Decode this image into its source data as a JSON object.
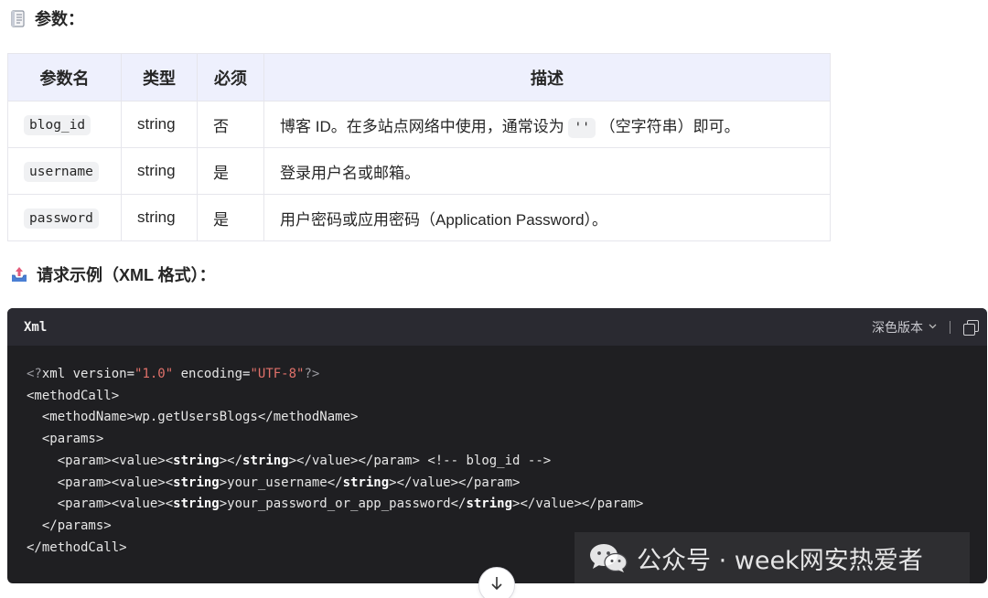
{
  "params_section": {
    "heading": "参数：",
    "icon": "document-icon"
  },
  "table": {
    "headers": [
      "参数名",
      "类型",
      "必须",
      "描述"
    ],
    "rows": [
      {
        "name": "blog_id",
        "type": "string",
        "required": "否",
        "desc_before": "博客 ID。在多站点网络中使用，通常设为",
        "desc_code": "''",
        "desc_after": "（空字符串）即可。"
      },
      {
        "name": "username",
        "type": "string",
        "required": "是",
        "desc": "登录用户名或邮箱。"
      },
      {
        "name": "password",
        "type": "string",
        "required": "是",
        "desc": "用户密码或应用密码（Application Password）。"
      }
    ]
  },
  "example_section": {
    "heading": "请求示例（XML 格式）：",
    "icon": "outbox-tray-icon"
  },
  "code_block": {
    "language": "Xml",
    "theme_label": "深色版本",
    "copy_icon": "copy-icon",
    "lines": {
      "l1_pi_open": "<?",
      "l1_a": "xml version=",
      "l1_v1": "\"1.0\"",
      "l1_b": " encoding=",
      "l1_v2": "\"UTF-8\"",
      "l1_pi_close": "?>",
      "l2": "<methodCall>",
      "l3": "  <methodName>wp.getUsersBlogs</methodName>",
      "l4": "  <params>",
      "l5_a": "    <param><value><",
      "l5_b1": "string",
      "l5_c": "></",
      "l5_b2": "string",
      "l5_d": "></value></param> <!-- blog_id -->",
      "l6_a": "    <param><value><",
      "l6_b1": "string",
      "l6_c": ">your_username</",
      "l6_b2": "string",
      "l6_d": "></value></param>",
      "l7_a": "    <param><value><",
      "l7_b1": "string",
      "l7_c": ">your_password_or_app_password</",
      "l7_b2": "string",
      "l7_d": "></value></param>",
      "l8": "  </params>",
      "l9": "</methodCall>"
    }
  },
  "watermark": {
    "text": "公众号 · week网安热爱者",
    "icon": "wechat-icon"
  },
  "scroll_button": {
    "icon": "arrow-down-icon"
  },
  "colors": {
    "table_header_bg": "#eef0fd",
    "code_bg": "#1f1f22",
    "code_header_bg": "#2a2a31",
    "string_literal": "#e0716a"
  }
}
